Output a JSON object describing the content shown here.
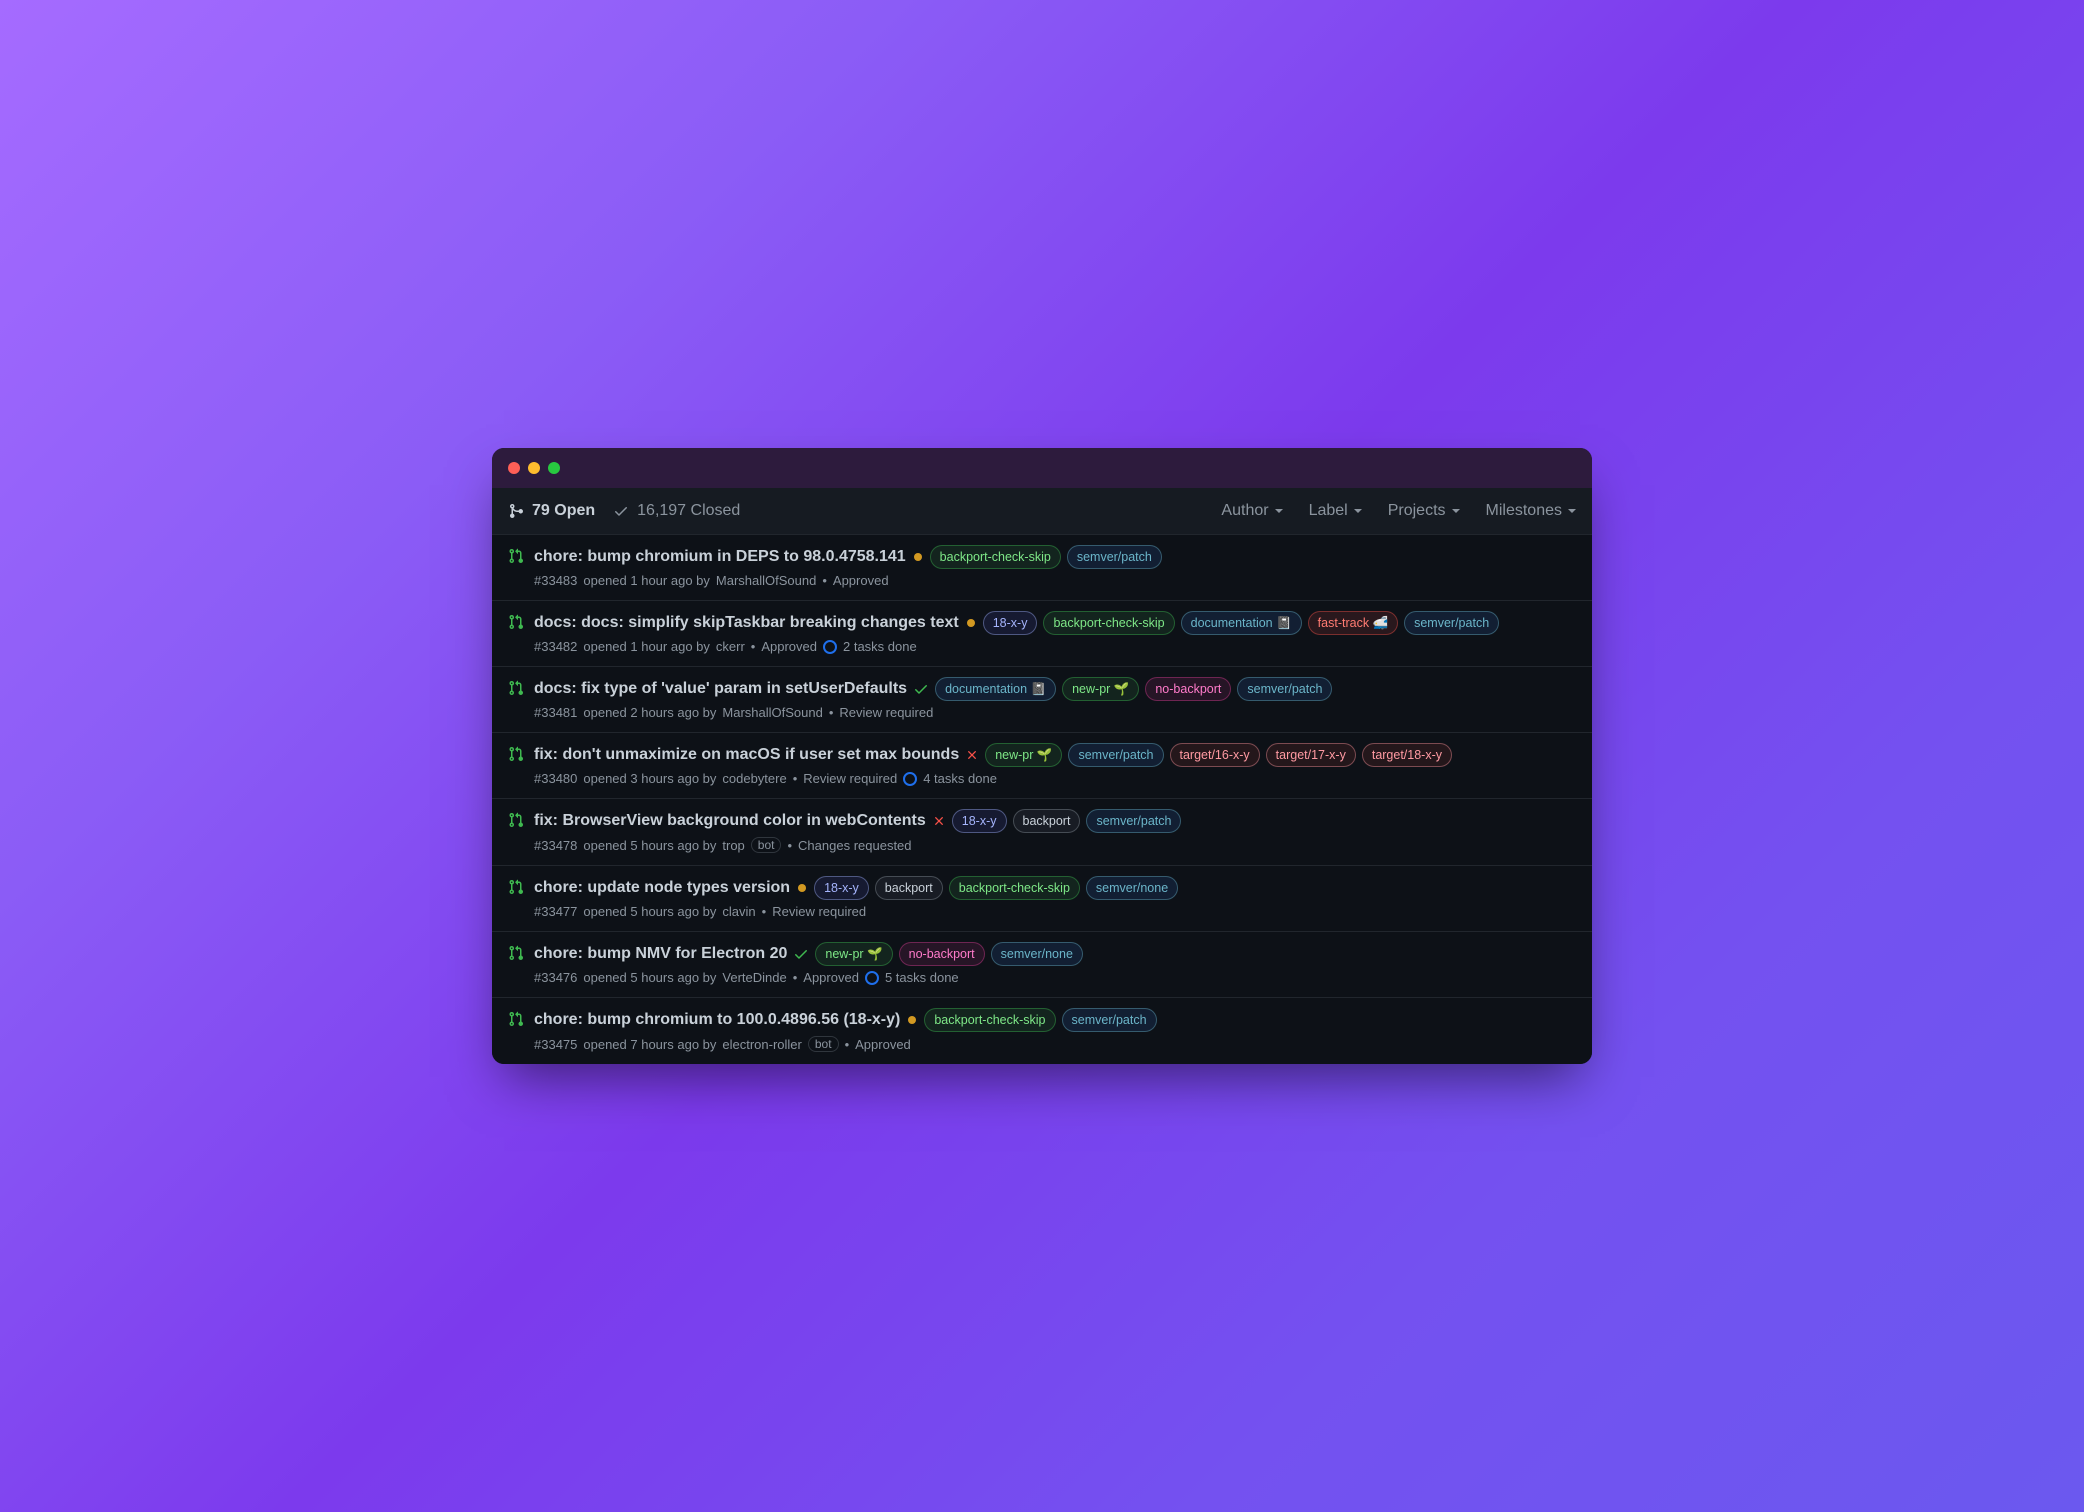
{
  "toolbar": {
    "open_label": "79 Open",
    "closed_label": "16,197 Closed",
    "filters": [
      "Author",
      "Label",
      "Projects",
      "Milestones"
    ]
  },
  "labels": {
    "backport-check-skip": {
      "text": "backport-check-skip",
      "color": "#7ee787",
      "bg": "rgba(63,185,80,0.12)",
      "border": "rgba(63,185,80,0.4)"
    },
    "semver-patch": {
      "text": "semver/patch",
      "color": "#6bb5c9",
      "bg": "rgba(56,139,253,0.12)",
      "border": "rgba(107,181,201,0.4)"
    },
    "18-x-y": {
      "text": "18-x-y",
      "color": "#a5b4fc",
      "bg": "rgba(88,101,242,0.12)",
      "border": "rgba(165,180,252,0.4)"
    },
    "documentation": {
      "text": "documentation 📓",
      "color": "#6bb5c9",
      "bg": "rgba(56,139,253,0.12)",
      "border": "rgba(107,181,201,0.4)"
    },
    "fast-track": {
      "text": "fast-track 🚅",
      "color": "#ff7b72",
      "bg": "rgba(248,81,73,0.12)",
      "border": "rgba(248,81,73,0.4)"
    },
    "new-pr": {
      "text": "new-pr 🌱",
      "color": "#7ee787",
      "bg": "rgba(63,185,80,0.12)",
      "border": "rgba(63,185,80,0.4)"
    },
    "no-backport": {
      "text": "no-backport",
      "color": "#ff7bca",
      "bg": "rgba(219,61,151,0.12)",
      "border": "rgba(219,61,151,0.4)"
    },
    "target-16": {
      "text": "target/16-x-y",
      "color": "#ff9aa2",
      "bg": "rgba(248,81,73,0.1)",
      "border": "rgba(255,154,162,0.4)"
    },
    "target-17": {
      "text": "target/17-x-y",
      "color": "#ff9aa2",
      "bg": "rgba(248,81,73,0.1)",
      "border": "rgba(255,154,162,0.4)"
    },
    "target-18": {
      "text": "target/18-x-y",
      "color": "#ff9aa2",
      "bg": "rgba(248,81,73,0.1)",
      "border": "rgba(255,154,162,0.4)"
    },
    "backport": {
      "text": "backport",
      "color": "#c9d1d9",
      "bg": "rgba(110,118,129,0.12)",
      "border": "rgba(139,148,158,0.4)"
    },
    "semver-none": {
      "text": "semver/none",
      "color": "#6bb5c9",
      "bg": "rgba(56,139,253,0.12)",
      "border": "rgba(107,181,201,0.4)"
    }
  },
  "prs": [
    {
      "title": "chore: bump chromium in DEPS to 98.0.4758.141",
      "status": "pending",
      "labels": [
        "backport-check-skip",
        "semver-patch"
      ],
      "id": "#33483",
      "opened": "opened 1 hour ago by",
      "author": "MarshallOfSound",
      "bot": false,
      "review": "Approved",
      "tasks": null
    },
    {
      "title": "docs: docs: simplify skipTaskbar breaking changes text",
      "status": "pending",
      "labels": [
        "18-x-y",
        "backport-check-skip",
        "documentation",
        "fast-track",
        "semver-patch"
      ],
      "id": "#33482",
      "opened": "opened 1 hour ago by",
      "author": "ckerr",
      "bot": false,
      "review": "Approved",
      "tasks": "2 tasks done"
    },
    {
      "title": "docs: fix type of 'value' param in setUserDefaults",
      "status": "success",
      "labels": [
        "documentation",
        "new-pr",
        "no-backport",
        "semver-patch"
      ],
      "id": "#33481",
      "opened": "opened 2 hours ago by",
      "author": "MarshallOfSound",
      "bot": false,
      "review": "Review required",
      "tasks": null
    },
    {
      "title": "fix: don't unmaximize on macOS if user set max bounds",
      "status": "failure",
      "labels": [
        "new-pr",
        "semver-patch",
        "target-16",
        "target-17",
        "target-18"
      ],
      "id": "#33480",
      "opened": "opened 3 hours ago by",
      "author": "codebytere",
      "bot": false,
      "review": "Review required",
      "tasks": "4 tasks done"
    },
    {
      "title": "fix: BrowserView background color in webContents",
      "status": "failure",
      "labels": [
        "18-x-y",
        "backport",
        "semver-patch"
      ],
      "id": "#33478",
      "opened": "opened 5 hours ago by",
      "author": "trop",
      "bot": true,
      "review": "Changes requested",
      "tasks": null
    },
    {
      "title": "chore: update node types version",
      "status": "pending",
      "labels": [
        "18-x-y",
        "backport",
        "backport-check-skip",
        "semver-none"
      ],
      "id": "#33477",
      "opened": "opened 5 hours ago by",
      "author": "clavin",
      "bot": false,
      "review": "Review required",
      "tasks": null
    },
    {
      "title": "chore: bump NMV for Electron 20",
      "status": "success",
      "labels": [
        "new-pr",
        "no-backport",
        "semver-none"
      ],
      "id": "#33476",
      "opened": "opened 5 hours ago by",
      "author": "VerteDinde",
      "bot": false,
      "review": "Approved",
      "tasks": "5 tasks done"
    },
    {
      "title": "chore: bump chromium to 100.0.4896.56 (18-x-y)",
      "status": "pending",
      "labels": [
        "backport-check-skip",
        "semver-patch"
      ],
      "id": "#33475",
      "opened": "opened 7 hours ago by",
      "author": "electron-roller",
      "bot": true,
      "review": "Approved",
      "tasks": null
    }
  ],
  "bot_text": "bot"
}
